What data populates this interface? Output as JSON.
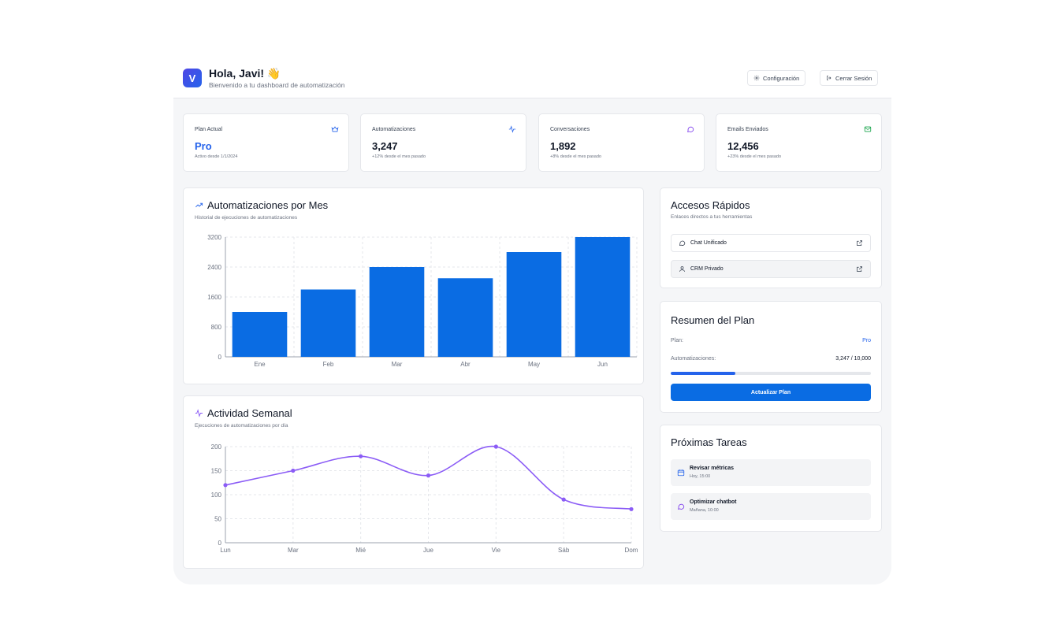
{
  "header": {
    "logo_letter": "V",
    "greeting": "Hola, Javi! 👋",
    "subtitle": "Bienvenido a tu dashboard de automatización",
    "settings_label": "Configuración",
    "logout_label": "Cerrar Sesión"
  },
  "stats": [
    {
      "label": "Plan Actual",
      "value": "Pro",
      "sub": "Activo desde 1/1/2024",
      "icon": "crown-icon",
      "color": "#2563eb"
    },
    {
      "label": "Automatizaciones",
      "value": "3,247",
      "sub": "+12% desde el mes pasado",
      "icon": "activity-icon",
      "color": "#2563eb"
    },
    {
      "label": "Conversaciones",
      "value": "1,892",
      "sub": "+8% desde el mes pasado",
      "icon": "chat-icon",
      "color": "#7c3aed"
    },
    {
      "label": "Emails Enviados",
      "value": "12,456",
      "sub": "+23% desde el mes pasado",
      "icon": "mail-icon",
      "color": "#16a34a"
    }
  ],
  "monthly": {
    "title": "Automatizaciones por Mes",
    "subtitle": "Historial de ejecuciones de automatizaciones"
  },
  "weekly": {
    "title": "Actividad Semanal",
    "subtitle": "Ejecuciones de automatizaciones por día"
  },
  "chart_data": [
    {
      "type": "bar",
      "title": "Automatizaciones por Mes",
      "categories": [
        "Ene",
        "Feb",
        "Mar",
        "Abr",
        "May",
        "Jun"
      ],
      "values": [
        1200,
        1800,
        2400,
        2100,
        2800,
        3200
      ],
      "yticks": [
        0,
        800,
        1600,
        2400,
        3200
      ],
      "ylim": [
        0,
        3200
      ],
      "color": "#0a6ce3",
      "grid": true
    },
    {
      "type": "line",
      "title": "Actividad Semanal",
      "categories": [
        "Lun",
        "Mar",
        "Mié",
        "Jue",
        "Vie",
        "Sáb",
        "Dom"
      ],
      "values": [
        120,
        150,
        180,
        140,
        200,
        90,
        70
      ],
      "yticks": [
        0,
        50,
        100,
        150,
        200
      ],
      "ylim": [
        0,
        200
      ],
      "color": "#8b5cf6",
      "grid": true
    }
  ],
  "quick_access": {
    "title": "Accesos Rápidos",
    "subtitle": "Enlaces directos a tus herramientas",
    "links": [
      {
        "label": "Chat Unificado",
        "icon": "chat-icon"
      },
      {
        "label": "CRM Privado",
        "icon": "user-icon"
      }
    ]
  },
  "plan_summary": {
    "title": "Resumen del Plan",
    "plan_label": "Plan:",
    "plan_value": "Pro",
    "usage_label": "Automatizaciones:",
    "usage_value": "3,247 / 10,000",
    "usage_fraction": 0.3247,
    "upgrade_label": "Actualizar Plan"
  },
  "tasks": {
    "title": "Próximas Tareas",
    "items": [
      {
        "title": "Revisar métricas",
        "time": "Hoy, 15:00",
        "icon": "calendar-icon"
      },
      {
        "title": "Optimizar chatbot",
        "time": "Mañana, 10:00",
        "icon": "chat-icon"
      }
    ]
  }
}
